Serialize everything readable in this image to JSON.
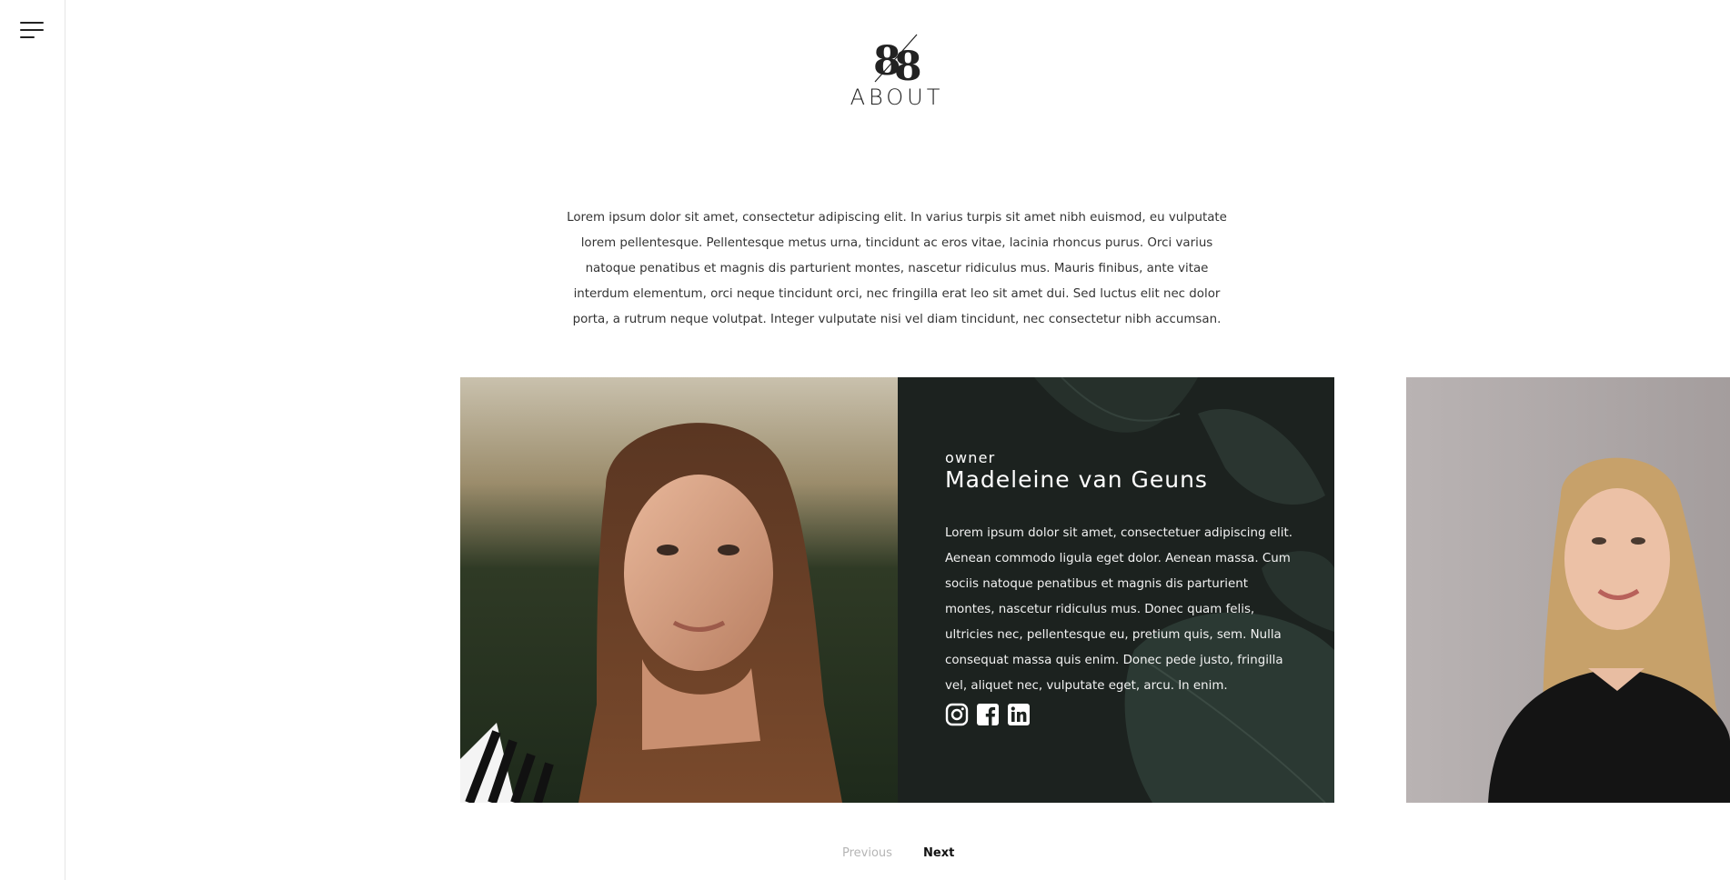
{
  "nav": {
    "menu_icon": "hamburger-menu-icon"
  },
  "header": {
    "logo_text": "88",
    "title": "ABOUT"
  },
  "intro": {
    "text": "Lorem ipsum dolor sit amet, consectetur adipiscing elit. In varius turpis sit amet nibh euismod, eu vulputate lorem pellentesque. Pellentesque metus urna, tincidunt ac eros vitae, lacinia rhoncus purus. Orci varius natoque penatibus et magnis dis parturient montes, nascetur ridiculus mus. Mauris finibus, ante vitae interdum elementum, orci neque tincidunt orci, nec fringilla erat leo sit amet dui. Sed luctus elit nec dolor porta, a rutrum neque volutpat. Integer vulputate nisi vel diam tincidunt, nec consectetur nibh accumsan."
  },
  "team": {
    "current": {
      "role": "owner",
      "name": "Madeleine van Geuns",
      "bio": "Lorem ipsum dolor sit amet, consectetuer adipiscing elit. Aenean commodo ligula eget dolor. Aenean massa. Cum sociis natoque penatibus et magnis dis parturient montes, nascetur ridiculus mus. Donec quam felis, ultricies nec, pellentesque eu, pretium quis, sem. Nulla consequat massa quis enim. Donec pede justo, fringilla vel, aliquet nec, vulputate eget, arcu. In enim.",
      "socials": [
        "instagram-icon",
        "facebook-icon",
        "linkedin-icon"
      ]
    }
  },
  "pagination": {
    "previous": "Previous",
    "next": "Next"
  },
  "colors": {
    "card_dark": "#1c221f",
    "pager_disabled": "#b5b5b5",
    "text": "#222222"
  }
}
